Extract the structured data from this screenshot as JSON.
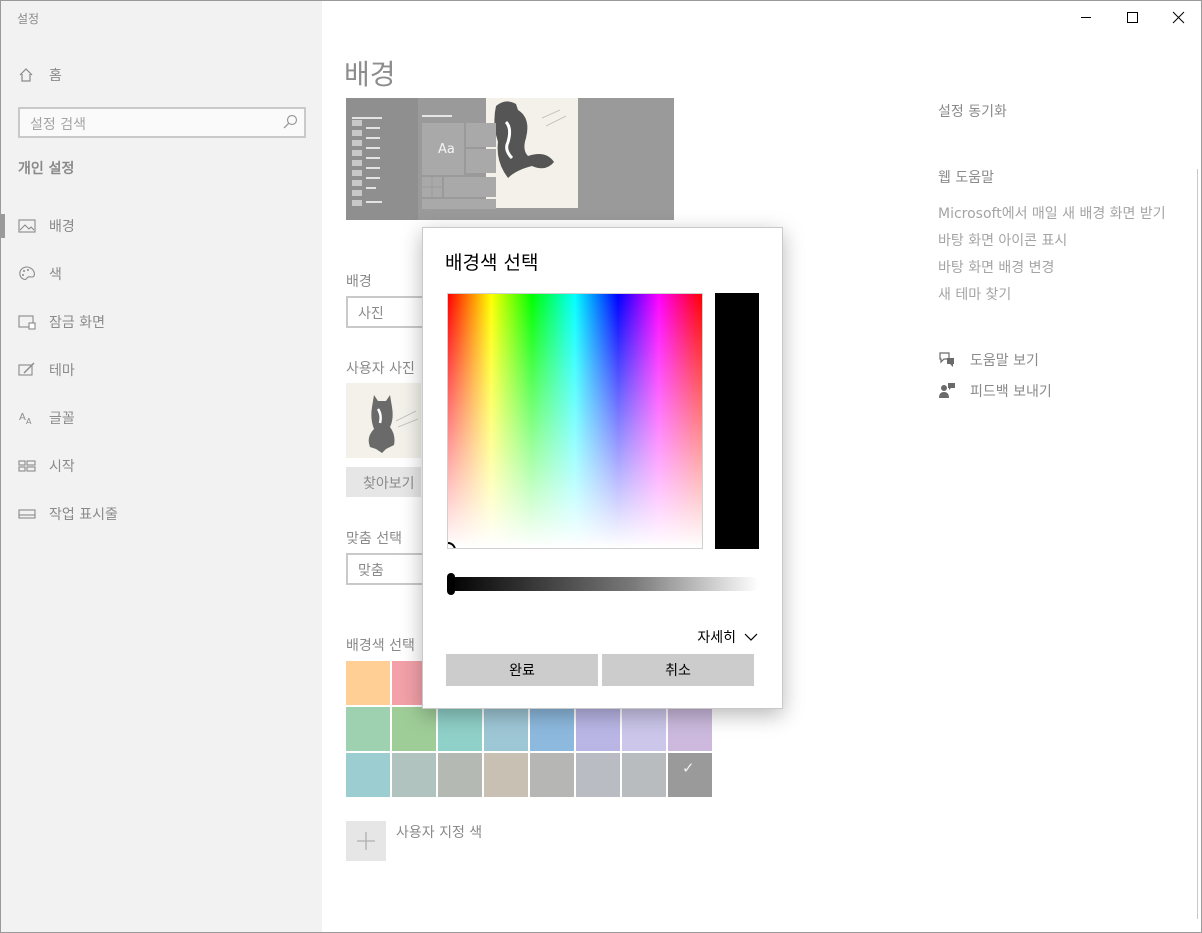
{
  "app": {
    "title": "설정"
  },
  "sidebar": {
    "home_label": "홈",
    "search_placeholder": "설정 검색",
    "section_title": "개인 설정",
    "items": [
      {
        "label": "배경",
        "icon": "picture-icon",
        "selected": true
      },
      {
        "label": "색",
        "icon": "palette-icon",
        "selected": false
      },
      {
        "label": "잠금 화면",
        "icon": "lock-screen-icon",
        "selected": false
      },
      {
        "label": "테마",
        "icon": "theme-icon",
        "selected": false
      },
      {
        "label": "글꼴",
        "icon": "font-icon",
        "selected": false
      },
      {
        "label": "시작",
        "icon": "start-icon",
        "selected": false
      },
      {
        "label": "작업 표시줄",
        "icon": "taskbar-icon",
        "selected": false
      }
    ]
  },
  "main": {
    "page_title": "배경",
    "preview_tile_text": "Aa",
    "background_label": "배경",
    "background_value": "사진",
    "user_photo_label": "사용자 사진",
    "browse_label": "찾아보기",
    "fit_label": "맞춤 선택",
    "fit_value": "맞춤",
    "bg_color_label": "배경색 선택",
    "custom_color_label": "사용자 지정 색",
    "palette": [
      [
        "#ffcf96",
        "#f3a0a8",
        "#f0a8b6",
        "#e9a7c3",
        "#d9a9d6",
        "#c4a9d9",
        "#b4a7dc",
        "#a9b3dc"
      ],
      [
        "#9dd1b0",
        "#9fcd98",
        "#8fd0c8",
        "#9ec7d6",
        "#8db9de",
        "#b9b6e6",
        "#cbc6ea",
        "#ccb9dd"
      ],
      [
        "#9ccdd0",
        "#b0c3bf",
        "#b5b9b4",
        "#c9c0b4",
        "#b6b6b4",
        "#b9bdc3",
        "#b9bcbf",
        "#9a9a9a"
      ]
    ],
    "palette_selected_index": [
      2,
      7
    ]
  },
  "right": {
    "sync_label": "설정 동기화",
    "web_help_title": "웹 도움말",
    "links": [
      "Microsoft에서 매일 새 배경 화면 받기",
      "바탕 화면 아이콘 표시",
      "바탕 화면 배경 변경",
      "새 테마 찾기"
    ],
    "help_label": "도움말 보기",
    "feedback_label": "피드백 보내기"
  },
  "dialog": {
    "title": "배경색 선택",
    "current_color": "#000000",
    "brightness_value": 0,
    "more_label": "자세히",
    "done_label": "완료",
    "cancel_label": "취소"
  }
}
